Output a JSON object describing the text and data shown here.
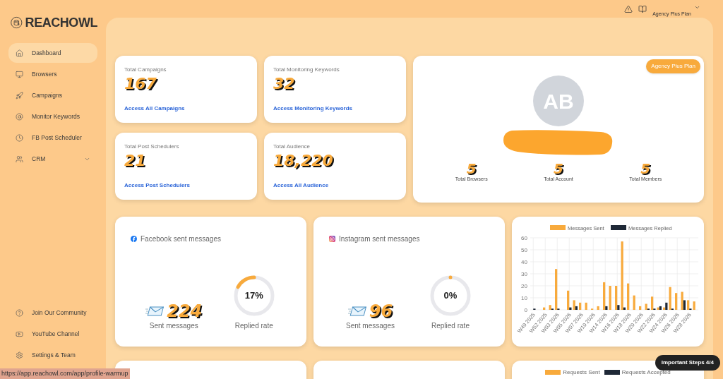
{
  "sidebar": {
    "logo": "REACHOWL",
    "items": [
      {
        "label": "Dashboard",
        "selected": true,
        "expandable": false
      },
      {
        "label": "Browsers",
        "selected": false,
        "expandable": false
      },
      {
        "label": "Campaigns",
        "selected": false,
        "expandable": false
      },
      {
        "label": "Monitor Keywords",
        "selected": false,
        "expandable": false
      },
      {
        "label": "FB Post Scheduler",
        "selected": false,
        "expandable": false
      },
      {
        "label": "CRM",
        "selected": false,
        "expandable": true
      }
    ],
    "footer_items": [
      {
        "label": "Join Our Community"
      },
      {
        "label": "YouTube Channel"
      },
      {
        "label": "Settings & Team"
      }
    ]
  },
  "header": {
    "plan": "Agency Plus Plan"
  },
  "stats": [
    {
      "title": "Total Campaigns",
      "value": "167",
      "link": "Access All Campaigns"
    },
    {
      "title": "Total Monitoring Keywords",
      "value": "32",
      "link": "Access Monitoring Keywords"
    },
    {
      "title": "Total Post Schedulers",
      "value": "21",
      "link": "Access Post Schedulers"
    },
    {
      "title": "Total Audience",
      "value": "18,220",
      "link": "Access All Audience"
    }
  ],
  "profile": {
    "badge": "Agency Plus Plan",
    "initials": "AB",
    "counts": [
      {
        "value": "5",
        "label": "Total Browsers"
      },
      {
        "value": "5",
        "label": "Total Account"
      },
      {
        "value": "5",
        "label": "Total Members"
      }
    ]
  },
  "message_cards": [
    {
      "title": "Facebook sent messages",
      "sent": "224",
      "sent_label": "Sent messages",
      "rate": "17%",
      "level": 0.17,
      "rate_label": "Replied rate"
    },
    {
      "title": "Instagram sent messages",
      "sent": "96",
      "sent_label": "Sent messages",
      "rate": "0%",
      "level": 0,
      "rate_label": "Replied rate"
    }
  ],
  "messages_chart": {
    "chart_data": {
      "type": "bar",
      "categories": [
        "W49 2025",
        null,
        "W52 2025",
        null,
        "W03 2026",
        null,
        "W05 2026",
        null,
        "W07 2026",
        null,
        "W10 2026",
        null,
        "W14 2026",
        null,
        "W16 2026",
        null,
        "W18 2026",
        null,
        "W20 2026",
        null,
        "W22 2026",
        null,
        "W24 2026",
        null,
        "W26 2026",
        null,
        "W28 2026",
        null
      ],
      "grid": true,
      "legend": "top",
      "ylim": [
        0,
        60
      ],
      "yticks": [
        0,
        10,
        20,
        30,
        40,
        50,
        60
      ],
      "series": [
        {
          "name": "Messages Sent",
          "color": "#f8aa3c",
          "values": [
            0,
            0,
            2,
            4,
            34,
            0,
            16,
            8,
            6,
            6,
            1,
            3,
            23,
            20,
            20,
            57,
            22,
            12,
            3,
            5,
            11,
            2,
            2,
            19,
            14,
            15,
            8,
            7
          ]
        },
        {
          "name": "Messages Replied",
          "color": "#1f2937",
          "values": [
            1,
            0,
            0,
            1,
            1,
            0,
            2,
            3,
            0,
            0,
            0,
            0,
            3,
            0,
            4,
            2,
            0,
            0,
            0,
            1,
            1,
            3,
            6,
            1,
            0,
            8,
            1,
            0
          ]
        }
      ]
    }
  },
  "requests_chart_legend": [
    {
      "name": "Requests Sent",
      "color": "#f8aa3c"
    },
    {
      "name": "Requests Accepted",
      "color": "#1f2937"
    }
  ],
  "status_url": "https://app.reachowl.com/app/profile-warmup",
  "steps_button": "Important Steps 4/4"
}
